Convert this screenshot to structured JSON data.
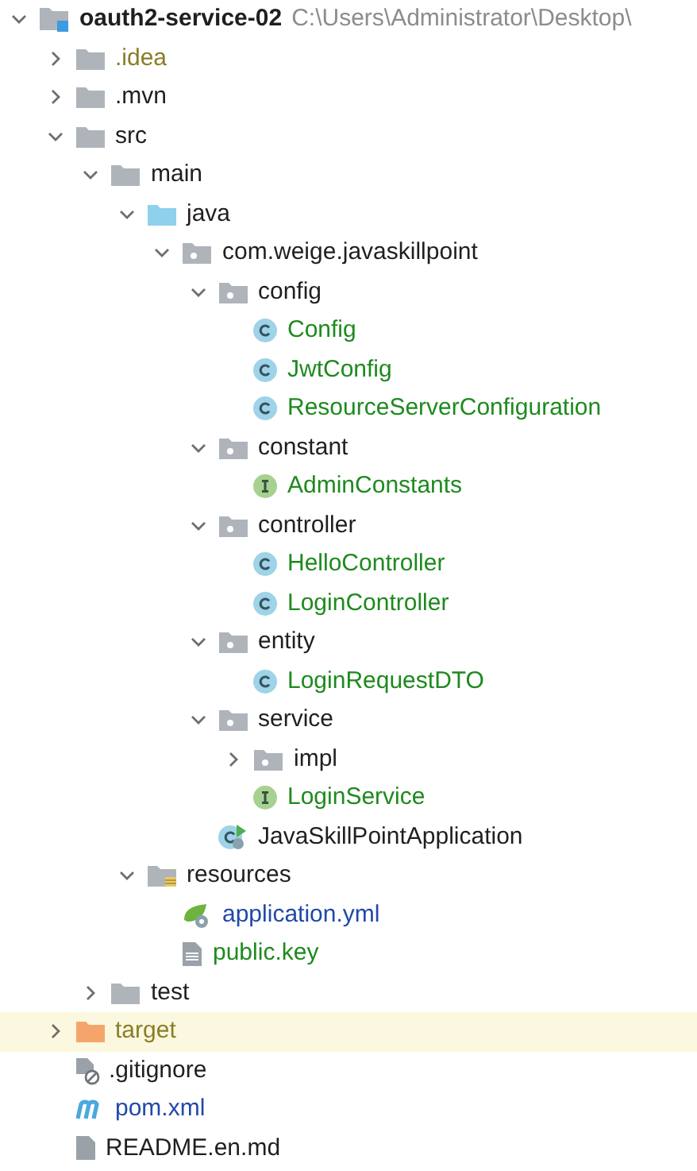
{
  "tree": [
    {
      "kind": "module",
      "label": "oauth2-service-02",
      "path": "C:\\Users\\Administrator\\Desktop\\",
      "color": "#1f1f1f",
      "highlighted": false,
      "expanded": true,
      "children": [
        {
          "kind": "folder",
          "label": ".idea",
          "color": "#8a7d2a",
          "highlighted": false,
          "expanded": false
        },
        {
          "kind": "folder",
          "label": ".mvn",
          "color": "#1f1f1f",
          "highlighted": false,
          "expanded": false
        },
        {
          "kind": "folder",
          "label": "src",
          "color": "#1f1f1f",
          "highlighted": false,
          "expanded": true,
          "children": [
            {
              "kind": "folder",
              "label": "main",
              "color": "#1f1f1f",
              "highlighted": false,
              "expanded": true,
              "children": [
                {
                  "kind": "source",
                  "label": "java",
                  "color": "#1f1f1f",
                  "highlighted": false,
                  "expanded": true,
                  "children": [
                    {
                      "kind": "package",
                      "label": "com.weige.javaskillpoint",
                      "color": "#1f1f1f",
                      "highlighted": false,
                      "expanded": true,
                      "children": [
                        {
                          "kind": "package",
                          "label": "config",
                          "color": "#1f1f1f",
                          "highlighted": false,
                          "expanded": true,
                          "children": [
                            {
                              "kind": "class",
                              "label": "Config",
                              "color": "#1e8a1e",
                              "highlighted": false
                            },
                            {
                              "kind": "class",
                              "label": "JwtConfig",
                              "color": "#1e8a1e",
                              "highlighted": false
                            },
                            {
                              "kind": "class",
                              "label": "ResourceServerConfiguration",
                              "color": "#1e8a1e",
                              "highlighted": false
                            }
                          ]
                        },
                        {
                          "kind": "package",
                          "label": "constant",
                          "color": "#1f1f1f",
                          "highlighted": false,
                          "expanded": true,
                          "children": [
                            {
                              "kind": "interface",
                              "label": "AdminConstants",
                              "color": "#1e8a1e",
                              "highlighted": false
                            }
                          ]
                        },
                        {
                          "kind": "package",
                          "label": "controller",
                          "color": "#1f1f1f",
                          "highlighted": false,
                          "expanded": true,
                          "children": [
                            {
                              "kind": "class",
                              "label": "HelloController",
                              "color": "#1e8a1e",
                              "highlighted": false
                            },
                            {
                              "kind": "class",
                              "label": "LoginController",
                              "color": "#1e8a1e",
                              "highlighted": false
                            }
                          ]
                        },
                        {
                          "kind": "package",
                          "label": "entity",
                          "color": "#1f1f1f",
                          "highlighted": false,
                          "expanded": true,
                          "children": [
                            {
                              "kind": "class",
                              "label": "LoginRequestDTO",
                              "color": "#1e8a1e",
                              "highlighted": false
                            }
                          ]
                        },
                        {
                          "kind": "package",
                          "label": "service",
                          "color": "#1f1f1f",
                          "highlighted": false,
                          "expanded": true,
                          "children": [
                            {
                              "kind": "package",
                              "label": "impl",
                              "color": "#1f1f1f",
                              "highlighted": false,
                              "expanded": false
                            },
                            {
                              "kind": "interface",
                              "label": "LoginService",
                              "color": "#1e8a1e",
                              "highlighted": false
                            }
                          ]
                        },
                        {
                          "kind": "app",
                          "label": "JavaSkillPointApplication",
                          "color": "#1f1f1f",
                          "highlighted": false
                        }
                      ]
                    }
                  ]
                },
                {
                  "kind": "resources",
                  "label": "resources",
                  "color": "#1f1f1f",
                  "highlighted": false,
                  "expanded": true,
                  "children": [
                    {
                      "kind": "yml",
                      "label": "application.yml",
                      "color": "#2249a8",
                      "highlighted": false
                    },
                    {
                      "kind": "file",
                      "label": "public.key",
                      "color": "#1e8a1e",
                      "highlighted": false
                    }
                  ]
                }
              ]
            },
            {
              "kind": "folder",
              "label": "test",
              "color": "#1f1f1f",
              "highlighted": false,
              "expanded": false
            }
          ]
        },
        {
          "kind": "excluded",
          "label": "target",
          "color": "#8a7d2a",
          "highlighted": true,
          "expanded": false
        },
        {
          "kind": "gitignore",
          "label": ".gitignore",
          "color": "#1f1f1f",
          "highlighted": false
        },
        {
          "kind": "maven",
          "label": "pom.xml",
          "color": "#2249a8",
          "highlighted": false
        },
        {
          "kind": "markdown",
          "label": "README.en.md",
          "color": "#1f1f1f",
          "highlighted": false
        }
      ]
    }
  ]
}
